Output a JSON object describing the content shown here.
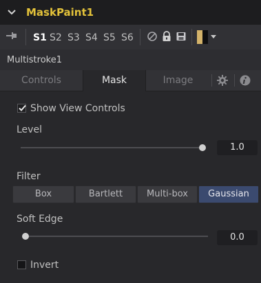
{
  "header": {
    "title": "MaskPaint1"
  },
  "versions": {
    "items": [
      "S1",
      "S2",
      "S3",
      "S4",
      "S5",
      "S6"
    ],
    "active_index": 0
  },
  "node": {
    "name": "Multistroke1"
  },
  "tabs": [
    "Controls",
    "Mask",
    "Image"
  ],
  "active_tab": "Mask",
  "mask": {
    "show_view_controls": {
      "label": "Show View Controls",
      "checked": true
    },
    "level": {
      "label": "Level",
      "value": "1.0",
      "fraction": 1.0
    },
    "filter": {
      "label": "Filter",
      "options": [
        "Box",
        "Bartlett",
        "Multi-box",
        "Gaussian"
      ],
      "selected": "Gaussian"
    },
    "soft_edge": {
      "label": "Soft Edge",
      "value": "0.0",
      "fraction": 0.0
    },
    "invert": {
      "label": "Invert",
      "checked": false
    }
  },
  "colors": {
    "title": "#e3c23a",
    "active_filter": "#3b4a6f"
  }
}
